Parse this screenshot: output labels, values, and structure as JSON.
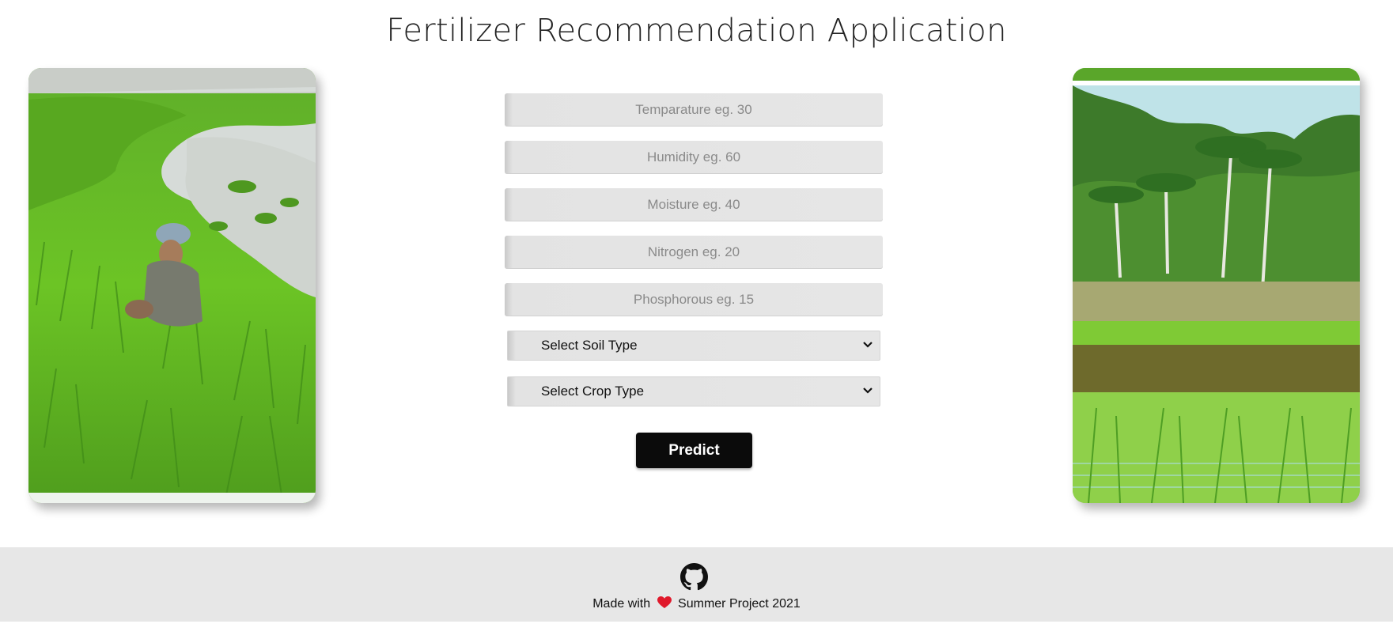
{
  "header": {
    "title": "Fertilizer Recommendation Application"
  },
  "images": {
    "left": "rice-paddy-farmer-image",
    "right": "palm-trees-paddy-field-image"
  },
  "form": {
    "temperature_placeholder": "Temparature eg. 30",
    "humidity_placeholder": "Humidity eg. 60",
    "moisture_placeholder": "Moisture eg. 40",
    "nitrogen_placeholder": "Nitrogen eg. 20",
    "phosphorous_placeholder": "Phosphorous eg. 15",
    "soil_select_value": "Select Soil Type",
    "crop_select_value": "Select Crop Type",
    "predict_label": "Predict"
  },
  "footer": {
    "made_with": "Made with",
    "project": "Summer Project 2021",
    "icons": [
      "github-icon",
      "heart-icon"
    ]
  },
  "colors": {
    "button_bg": "#0b0b0b",
    "footer_bg": "#e7e7e7",
    "heart": "#e0192b"
  }
}
